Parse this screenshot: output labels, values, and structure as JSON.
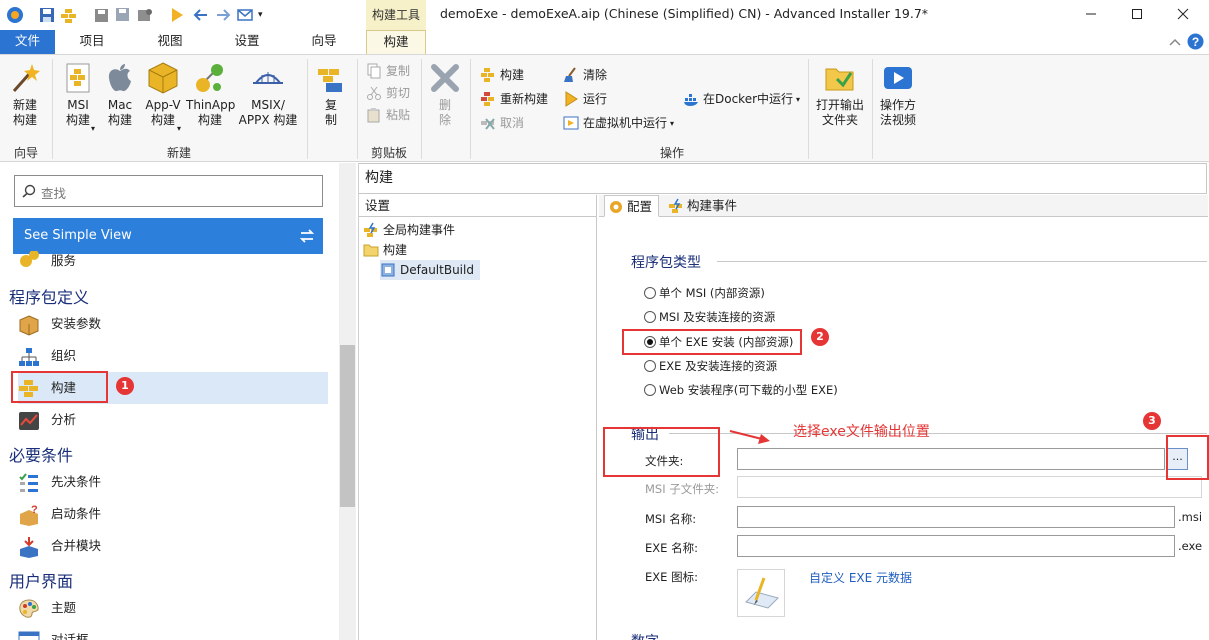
{
  "app": {
    "title": "demoExe - demoExeA.aip (Chinese (Simplified) CN) - Advanced Installer 19.7*",
    "context_tab_group": "构建工具"
  },
  "menu_tabs": [
    {
      "label": "文件"
    },
    {
      "label": "项目"
    },
    {
      "label": "视图"
    },
    {
      "label": "设置"
    },
    {
      "label": "向导"
    },
    {
      "label": "构建"
    }
  ],
  "ribbon": {
    "groups": {
      "wizard": "向导",
      "new": "新建",
      "clipboard": "剪贴板",
      "actions": "操作"
    },
    "new_build": "新建\n构建",
    "msi_build": "MSI\n构建",
    "mac_build": "Mac\n构建",
    "appv_build": "App-V\n构建",
    "thinapp_build": "ThinApp\n构建",
    "msix_build": "MSIX/\nAPPX 构建",
    "copy_large": "复\n制",
    "copy": "复制",
    "cut": "剪切",
    "paste": "粘贴",
    "delete": "删\n除",
    "build": "构建",
    "rebuild": "重新构建",
    "cancel": "取消",
    "clean": "清除",
    "run": "运行",
    "run_in_vm": "在虚拟机中运行",
    "run_in_docker": "在Docker中运行",
    "open_output": "打开输出\n文件夹",
    "howto_video": "操作方\n法视频"
  },
  "left_panel": {
    "search_placeholder": "查找",
    "simple_view": "See Simple View",
    "partial_item": "服务",
    "categories": {
      "package": "程序包定义",
      "requirements": "必要条件",
      "ui": "用户界面"
    },
    "items": {
      "install_params": "安装参数",
      "organization": "组织",
      "builds": "构建",
      "analytics": "分析",
      "prerequisites": "先决条件",
      "launch_conditions": "启动条件",
      "merge_modules": "合并模块",
      "themes": "主题",
      "dialogs": "对话框"
    }
  },
  "main": {
    "section_title": "构建",
    "tree": {
      "header": "设置",
      "global_events": "全局构建事件",
      "builds": "构建",
      "default_build": "DefaultBuild"
    },
    "tabs": {
      "config": "配置",
      "build_events": "构建事件"
    },
    "package_type": {
      "heading": "程序包类型",
      "options": [
        {
          "label": "单个 MSI (内部资源)",
          "selected": false
        },
        {
          "label": "MSI 及安装连接的资源",
          "selected": false
        },
        {
          "label": "单个 EXE 安装 (内部资源)",
          "selected": true
        },
        {
          "label": "EXE 及安装连接的资源",
          "selected": false
        },
        {
          "label": "Web 安装程序(可下载的小型 EXE)",
          "selected": false
        }
      ]
    },
    "output": {
      "heading": "输出",
      "folder_label": "文件夹:",
      "folder_value": "",
      "browse": "...",
      "msi_subfolder_label": "MSI 子文件夹:",
      "msi_name_label": "MSI 名称:",
      "msi_ext": ".msi",
      "exe_name_label": "EXE 名称:",
      "exe_ext": ".exe",
      "exe_icon_label": "EXE 图标:",
      "custom_metadata": "自定义 EXE 元数据",
      "next_heading_partial": "数字"
    }
  },
  "annotations": {
    "badge1": "1",
    "badge2": "2",
    "badge3": "3",
    "note": "选择exe文件输出位置",
    "color": "#e53535"
  }
}
